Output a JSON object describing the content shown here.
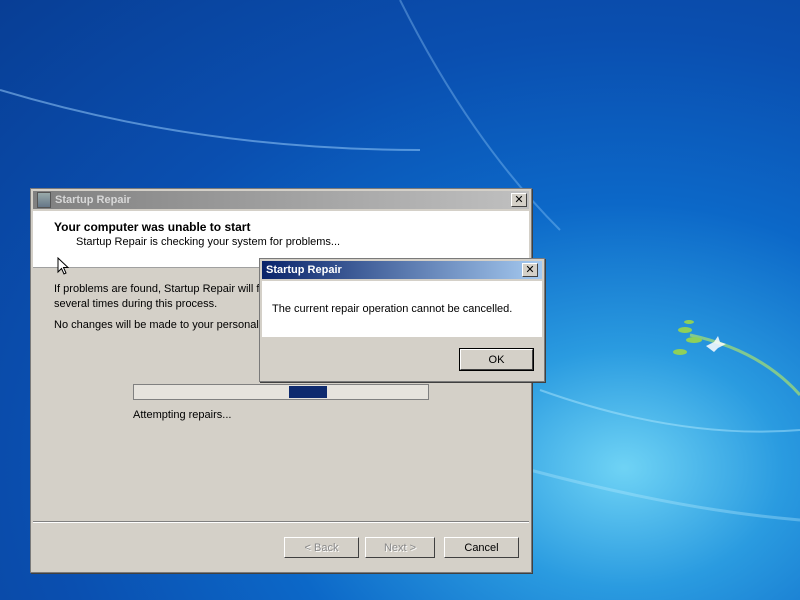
{
  "main_window": {
    "title": "Startup Repair",
    "heading": "Your computer was unable to start",
    "subheading": "Startup Repair is checking your system for problems...",
    "paragraph1": "If problems are found, Startup Repair will f\nseveral times during this process.",
    "paragraph2": "No changes will be made to your personal f",
    "progress_status": "Attempting repairs...",
    "buttons": {
      "back": "< Back",
      "next": "Next >",
      "cancel": "Cancel"
    }
  },
  "dialog": {
    "title": "Startup Repair",
    "message": "The current repair operation cannot be cancelled.",
    "ok_label": "OK"
  },
  "colors": {
    "active_title": "#0a246a",
    "progress_chunk": "#0e2a6e",
    "desktop_bg": "#0a4fb0"
  }
}
